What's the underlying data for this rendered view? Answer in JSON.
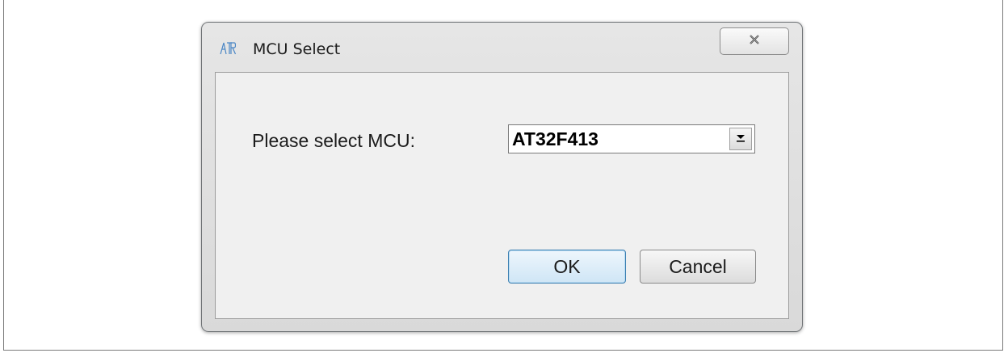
{
  "window": {
    "title": "MCU Select",
    "app_icon": "artery-logo-icon",
    "close_icon": "close-icon"
  },
  "form": {
    "prompt_label": "Please select MCU:",
    "mcu_select": {
      "selected_value": "AT32F413",
      "arrow_icon": "dropdown-arrow-icon"
    }
  },
  "buttons": {
    "ok_label": "OK",
    "cancel_label": "Cancel"
  }
}
